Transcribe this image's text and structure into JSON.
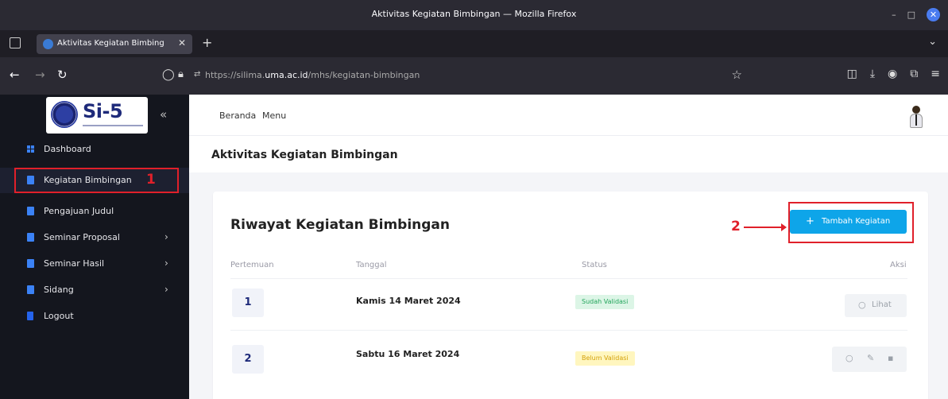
{
  "window": {
    "title": "Aktivitas Kegiatan Bimbingan — Mozilla Firefox"
  },
  "browser": {
    "tab_title": "Aktivitas Kegiatan Bimbing",
    "url_prefix": "https://silima.",
    "url_domain": "uma.ac.id",
    "url_path": "/mhs/kegiatan-bimbingan"
  },
  "sidebar": {
    "logo_text": "Si-5",
    "collapse_icon": "«",
    "items": [
      {
        "label": "Dashboard",
        "icon": "grid-icon",
        "chevron": ""
      },
      {
        "label": "Kegiatan Bimbingan",
        "icon": "doc-icon",
        "chevron": ""
      },
      {
        "label": "Pengajuan Judul",
        "icon": "doc-icon",
        "chevron": ""
      },
      {
        "label": "Seminar Proposal",
        "icon": "doc-icon",
        "chevron": "›"
      },
      {
        "label": "Seminar Hasil",
        "icon": "doc-icon",
        "chevron": "›"
      },
      {
        "label": "Sidang",
        "icon": "doc-icon",
        "chevron": "›"
      },
      {
        "label": "Logout",
        "icon": "logout-icon",
        "chevron": ""
      }
    ]
  },
  "topnav": {
    "home": "Beranda",
    "menu": "Menu"
  },
  "page": {
    "title": "Aktivitas Kegiatan Bimbingan"
  },
  "card": {
    "title": "Riwayat Kegiatan Bimbingan",
    "add_button": "Tambah Kegiatan",
    "columns": {
      "meeting": "Pertemuan",
      "date": "Tanggal",
      "status": "Status",
      "action": "Aksi"
    },
    "rows": [
      {
        "number": "1",
        "date": "Kamis 14 Maret 2024",
        "status": "Sudah Validasi",
        "view_label": "Lihat"
      },
      {
        "number": "2",
        "date": "Sabtu 16 Maret 2024",
        "status": "Belum Validasi"
      }
    ]
  },
  "annotations": {
    "first": "1",
    "second": "2"
  },
  "colors": {
    "accent": "#0ea5e9",
    "annotation": "#e0202a",
    "sidebar_bg": "#14161e",
    "status_ok": "#22a55b",
    "status_pending": "#d4a10a"
  }
}
